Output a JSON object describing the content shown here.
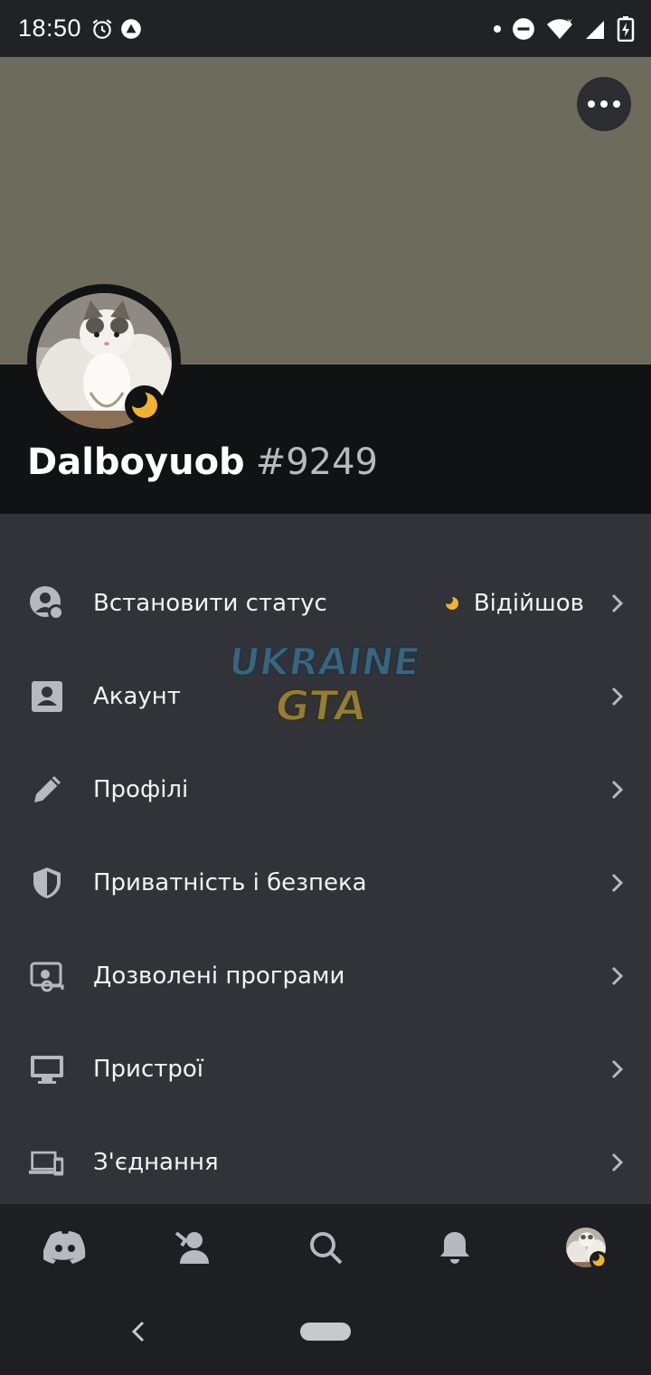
{
  "status_bar": {
    "time": "18:50",
    "icons": [
      "alarm-icon",
      "app-icon",
      "dot-icon",
      "do-not-disturb-icon",
      "wifi-icon",
      "signal-icon",
      "battery-charging-icon"
    ]
  },
  "profile": {
    "username": "Dalboyuob",
    "discriminator": "#9249",
    "status_icon": "moon-idle-icon",
    "status_color": "#f0b232",
    "banner_color": "#6d6b5c"
  },
  "settings": {
    "items": [
      {
        "label": "Встановити статус",
        "icon": "set-status-icon",
        "value": "Відійшов"
      },
      {
        "label": "Акаунт",
        "icon": "account-icon"
      },
      {
        "label": "Профілі",
        "icon": "pencil-icon"
      },
      {
        "label": "Приватність і безпека",
        "icon": "shield-icon"
      },
      {
        "label": "Дозволені програми",
        "icon": "authorized-apps-icon"
      },
      {
        "label": "Пристрої",
        "icon": "monitor-icon"
      },
      {
        "label": "З'єднання",
        "icon": "connections-icon"
      }
    ]
  },
  "watermark": {
    "line1": "UKRAINE",
    "line2": "GTA"
  },
  "bottom_nav": {
    "items": [
      "discord-home-icon",
      "friends-icon",
      "search-icon",
      "notifications-bell-icon",
      "profile-avatar"
    ]
  },
  "colors": {
    "background": "#313338",
    "header": "#111214",
    "nav": "#1e1f22",
    "idle": "#f0b232"
  }
}
